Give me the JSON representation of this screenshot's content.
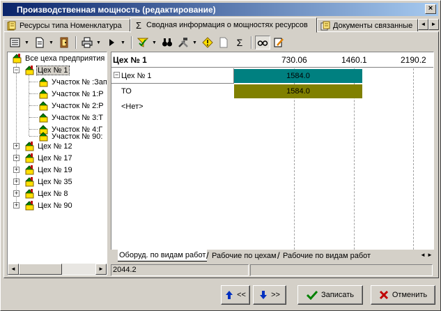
{
  "window": {
    "title": "Производственная мощность (редактирование)",
    "close_glyph": "×"
  },
  "tabs": [
    {
      "label": "Ресурсы типа Номенклатура",
      "icon": "resource-book-icon"
    },
    {
      "label": "Сводная информация о мощностях ресурсов",
      "icon": "sigma-icon",
      "glyph": "Σ"
    },
    {
      "label": "Документы связанные",
      "icon": "documents-icon"
    }
  ],
  "tab_scroll": {
    "left": "◄",
    "right": "►"
  },
  "toolbar": {
    "sigma_glyph": "Σ",
    "icons": [
      "view-list-icon",
      "document-icon",
      "exit-icon",
      "print-icon",
      "play-icon",
      "filter-icon",
      "binoculars-icon",
      "tools-icon",
      "warning-icon",
      "blank-page-icon",
      "sigma-icon",
      "glasses-icon",
      "edit-icon"
    ]
  },
  "tree": {
    "items": [
      {
        "label": "Все цеха предприятия",
        "level": 0
      },
      {
        "label": "Цех № 1",
        "level": 1,
        "expanded": true,
        "selected": true
      },
      {
        "label": "Участок № :Зап",
        "level": 2
      },
      {
        "label": "Участок № 1:Р",
        "level": 2
      },
      {
        "label": "Участок № 2:Р",
        "level": 2
      },
      {
        "label": "Участок № 3:Т",
        "level": 2
      },
      {
        "label": "Участок № 4:Г",
        "level": 2
      },
      {
        "label": "Участок № 90:",
        "level": 2
      },
      {
        "label": "Цех № 12",
        "level": 1
      },
      {
        "label": "Цех № 17",
        "level": 1
      },
      {
        "label": "Цех № 19",
        "level": 1
      },
      {
        "label": "Цех № 35",
        "level": 1
      },
      {
        "label": "Цех № 8",
        "level": 1
      },
      {
        "label": "Цех № 90",
        "level": 1
      }
    ],
    "expand_glyph": "+",
    "collapse_glyph": "−"
  },
  "gantt": {
    "title": "Цех № 1",
    "ticks": [
      "730.06",
      "1460.1",
      "2190.2"
    ],
    "rows": [
      {
        "label": "Цех № 1",
        "value": "1584.0",
        "color": "#008080",
        "collapsible": true
      },
      {
        "label": "ТО",
        "value": "1584.0",
        "color": "#808000"
      },
      {
        "label": "<Нет>",
        "value": ""
      }
    ],
    "collapse_glyph": "−"
  },
  "bottom_tabs": [
    {
      "label": "Оборуд. по видам работ",
      "active": true
    },
    {
      "label": "Рабочие по цехам",
      "active": false
    },
    {
      "label": "Рабочие по видам работ",
      "active": false
    }
  ],
  "bottom_nav": {
    "prev": "◄",
    "next": "►"
  },
  "status": {
    "value": "2044.2"
  },
  "buttons": {
    "prev": {
      "label": "<<",
      "icon": "arrow-up-icon"
    },
    "next": {
      "label": ">>",
      "icon": "arrow-down-icon"
    },
    "save": {
      "label": "Записать",
      "icon": "checkmark-icon"
    },
    "cancel": {
      "label": "Отменить",
      "icon": "cross-icon"
    }
  },
  "colors": {
    "title_start": "#0a246a",
    "title_end": "#a6caf0",
    "bar_teal": "#008080",
    "bar_olive": "#808000"
  }
}
